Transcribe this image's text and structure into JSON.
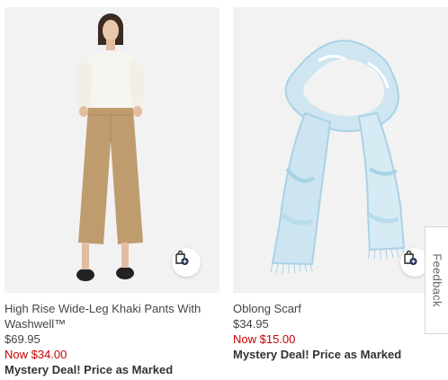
{
  "products": [
    {
      "title": "High Rise Wide-Leg Khaki Pants With Washwell™",
      "original_price": "$69.95",
      "sale_price": "Now $34.00",
      "promo": "Mystery Deal! Price as Marked",
      "image_icon": "woman-in-white-sweater-and-khaki-pants",
      "bag_icon": "add-to-bag-icon"
    },
    {
      "title": "Oblong Scarf",
      "original_price": "$34.95",
      "sale_price": "Now $15.00",
      "promo": "Mystery Deal! Price as Marked",
      "image_icon": "light-blue-tie-dye-scarf",
      "bag_icon": "add-to-bag-icon"
    }
  ],
  "feedback": {
    "label": "Feedback"
  },
  "colors": {
    "sale_price": "#c60000",
    "image_background": "#f2f2f2",
    "bag_icon_badge": "#1d2b4f"
  }
}
